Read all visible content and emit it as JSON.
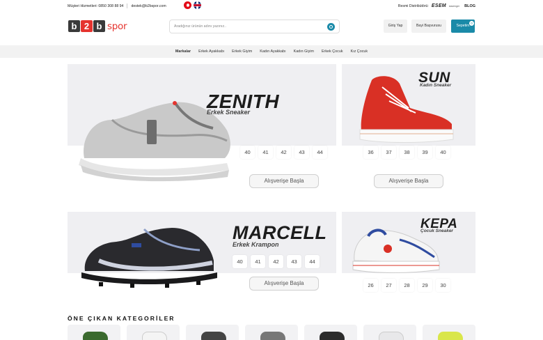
{
  "topbar": {
    "hotline": "Müşteri Hizmetleri: 0850 308 88 94",
    "email": "destek@b2bspor.com",
    "distributor_label": "Resmi Distribütörü:",
    "brand1": "ESEM",
    "brand2": "slazenger",
    "blog": "BLOG"
  },
  "header": {
    "logo_b1": "b",
    "logo_2": "2",
    "logo_b2": "b",
    "logo_spor": "spor",
    "search_placeholder": "Aradığınız ürünün adını yazınız..",
    "login": "Giriş Yap",
    "dealer": "Bayi Başvurusu",
    "cart": "Sepetim",
    "cart_count": "0"
  },
  "nav": [
    "Markalar",
    "Erkek Ayakkabı",
    "Erkek Giyim",
    "Kadın Ayakkabı",
    "Kadın Giyim",
    "Erkek Çocuk",
    "Kız Çocuk"
  ],
  "banners": [
    {
      "title": "ZENITH",
      "subtitle": "Erkek Sneaker",
      "sizes": [
        "40",
        "41",
        "42",
        "43",
        "44"
      ],
      "cta": "Alışverişe Başla"
    },
    {
      "title": "SUN",
      "subtitle": "Kadın Sneaker",
      "sizes": [
        "36",
        "37",
        "38",
        "39",
        "40"
      ],
      "cta": "Alışverişe Başla"
    },
    {
      "title": "MARCELL",
      "subtitle": "Erkek Krampon",
      "sizes": [
        "40",
        "41",
        "42",
        "43",
        "44"
      ],
      "cta": "Alışverişe Başla"
    },
    {
      "title": "KEPA",
      "subtitle": "Çocuk Sneaker",
      "sizes": [
        "26",
        "27",
        "28",
        "29",
        "30"
      ],
      "cta": ""
    }
  ],
  "section": {
    "title": "ÖNE ÇIKAN KATEGORİLER"
  },
  "colors": {
    "accent": "#1a8aa8",
    "brand_red": "#e5342f",
    "banner_bg": "#efeff2"
  }
}
